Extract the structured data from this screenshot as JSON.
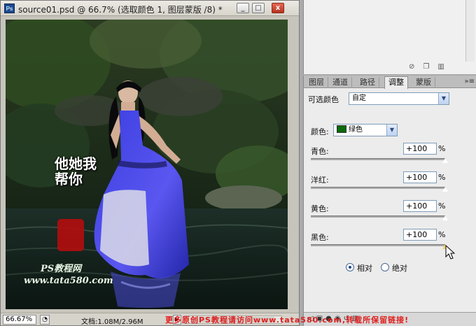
{
  "document": {
    "title": "source01.psd @ 66.7% (选取颜色 1, 图层蒙版 /8) *",
    "minimize": "_",
    "restore": "□",
    "close": "x",
    "app_icon": "Ps",
    "zoom": "66.67%",
    "doc_info": "文档:1.08M/2.96M",
    "overlay": {
      "calligraphy": "他她我帮你",
      "logo_text": "PS教程网",
      "url_text": "www.tata580.com"
    }
  },
  "panels": {
    "tabs": [
      {
        "label": "图层"
      },
      {
        "label": "通道"
      },
      {
        "label": "路径"
      },
      {
        "label": "调整"
      },
      {
        "label": "蒙版"
      }
    ],
    "active_tab": "调整",
    "menu_icon": "»≡",
    "adjust": {
      "title": "可选颜色",
      "preset": "自定",
      "colors_label": "颜色:",
      "colors_value": "绿色",
      "swatch_color": "#0a6b0a",
      "sliders": [
        {
          "label": "青色:",
          "value": "+100",
          "unit": "%",
          "level": 1.0
        },
        {
          "label": "洋红:",
          "value": "+100",
          "unit": "%",
          "level": 1.0
        },
        {
          "label": "黄色:",
          "value": "+100",
          "unit": "%",
          "level": 1.0
        },
        {
          "label": "黑色:",
          "value": "+100",
          "unit": "%",
          "level": 1.0
        }
      ],
      "method": {
        "relative": "相对",
        "absolute": "绝对",
        "selected": "relative"
      }
    }
  },
  "watermark": "更多原创PS教程请访问www.tata580.com,转载所保留链接!"
}
